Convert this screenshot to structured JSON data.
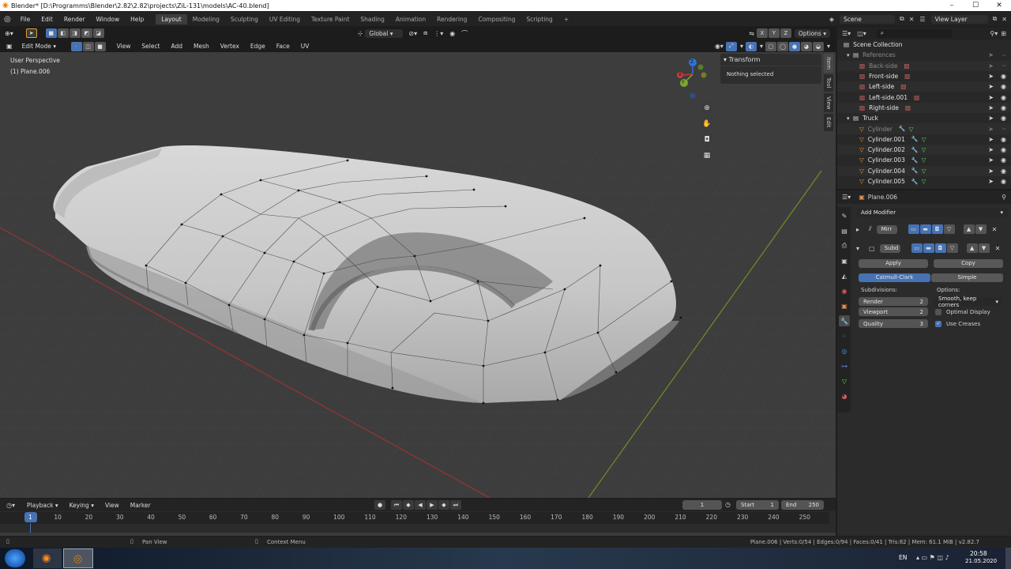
{
  "window": {
    "title": "Blender* [D:\\Programms\\Blender\\2.82\\2.82\\projects\\ZiL-131\\models\\AC-40.blend]"
  },
  "menus": [
    "File",
    "Edit",
    "Render",
    "Window",
    "Help"
  ],
  "workspaces": [
    "Layout",
    "Modeling",
    "Sculpting",
    "UV Editing",
    "Texture Paint",
    "Shading",
    "Animation",
    "Rendering",
    "Compositing",
    "Scripting"
  ],
  "active_workspace": "Layout",
  "scene": {
    "label": "Scene",
    "view_layer": "View Layer"
  },
  "viewport": {
    "header": {
      "orientation": "Global",
      "options": "Options",
      "mode": "Edit Mode",
      "menus": [
        "View",
        "Select",
        "Add",
        "Mesh",
        "Vertex",
        "Edge",
        "Face",
        "UV"
      ],
      "axes": [
        "X",
        "Y",
        "Z"
      ]
    },
    "overlay_text": {
      "perspective": "User Perspective",
      "object": "(1) Plane.006"
    },
    "n_panel": {
      "header": "Transform",
      "body": "Nothing selected",
      "tabs": [
        "Item",
        "Tool",
        "View",
        "Edit"
      ]
    },
    "gizmo": {
      "x": "X",
      "y": "Y",
      "z": "Z"
    }
  },
  "outliner": {
    "header": {
      "search_placeholder": ""
    },
    "root": "Scene Collection",
    "items": [
      {
        "name": "References",
        "type": "collection",
        "dim": true
      },
      {
        "name": "Back-side",
        "type": "image",
        "dim": true
      },
      {
        "name": "Front-side",
        "type": "image",
        "dim": false
      },
      {
        "name": "Left-side",
        "type": "image",
        "dim": false
      },
      {
        "name": "Left-side.001",
        "type": "image",
        "dim": false
      },
      {
        "name": "Right-side",
        "type": "image",
        "dim": false
      },
      {
        "name": "Truck",
        "type": "collection",
        "dim": false
      },
      {
        "name": "Cylinder",
        "type": "mesh",
        "dim": true
      },
      {
        "name": "Cylinder.001",
        "type": "mesh",
        "dim": false
      },
      {
        "name": "Cylinder.002",
        "type": "mesh",
        "dim": false
      },
      {
        "name": "Cylinder.003",
        "type": "mesh",
        "dim": false
      },
      {
        "name": "Cylinder.004",
        "type": "mesh",
        "dim": false
      },
      {
        "name": "Cylinder.005",
        "type": "mesh",
        "dim": false
      }
    ]
  },
  "properties": {
    "object_name": "Plane.006",
    "add_modifier": "Add Modifier",
    "mirror": {
      "name": "Mirr"
    },
    "subsurf": {
      "name": "Subd",
      "apply": "Apply",
      "copy": "Copy",
      "catmull": "Catmull-Clark",
      "simple": "Simple",
      "subdivisions_label": "Subdivisions:",
      "options_label": "Options:",
      "render_label": "Render",
      "render_value": "2",
      "viewport_label": "Viewport",
      "viewport_value": "2",
      "quality_label": "Quality",
      "quality_value": "3",
      "uv_smooth": "Smooth, keep corners",
      "optimal_display": "Optimal Display",
      "use_creases": "Use Creases",
      "optimal_checked": false,
      "creases_checked": true
    }
  },
  "timeline": {
    "menus": [
      "Playback",
      "Keying",
      "View",
      "Marker"
    ],
    "current_frame": "1",
    "start_label": "Start",
    "start": "1",
    "end_label": "End",
    "end": "250",
    "ticks": [
      "1",
      "10",
      "20",
      "30",
      "40",
      "50",
      "60",
      "70",
      "80",
      "90",
      "100",
      "110",
      "120",
      "130",
      "140",
      "150",
      "160",
      "170",
      "180",
      "190",
      "200",
      "210",
      "220",
      "230",
      "240",
      "250"
    ]
  },
  "statusbar": {
    "pan": "Pan View",
    "context": "Context Menu",
    "stats": "Plane.006 | Verts:0/54 | Edges:0/94 | Faces:0/41 | Tris:82 | Mem: 61.1 MiB | v2.82.7"
  },
  "taskbar": {
    "lang": "EN",
    "time": "20:58",
    "date": "21.05.2020"
  },
  "colors": {
    "accent": "#4772b3",
    "x_axis": "#c23c3c",
    "y_axis": "#7ea52e",
    "z_axis": "#2d74d8",
    "mesh": "#f09a35"
  }
}
